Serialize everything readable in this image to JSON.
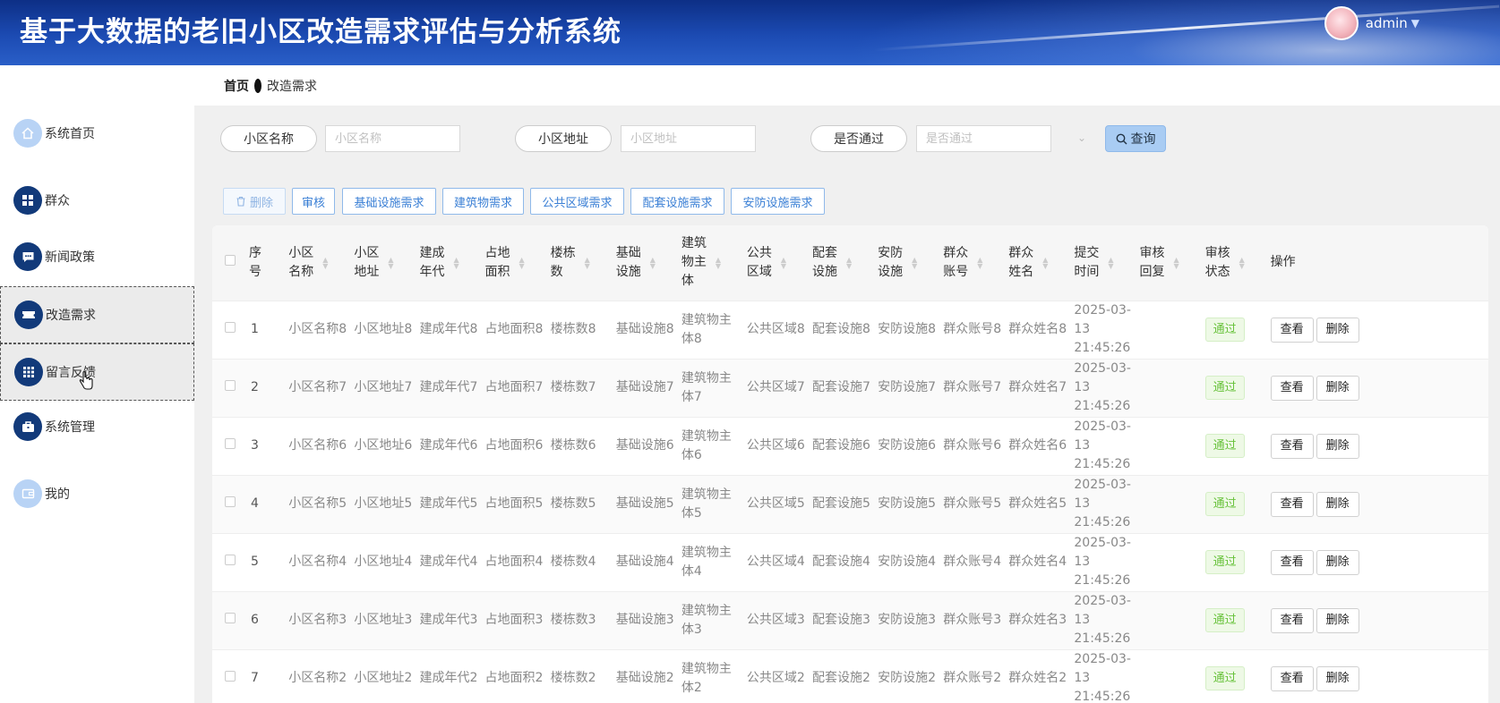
{
  "header": {
    "title": "基于大数据的老旧小区改造需求评估与分析系统",
    "user": "admin"
  },
  "sidebar": {
    "items": [
      {
        "label": "系统首页",
        "icon": "home-icon"
      },
      {
        "label": "群众",
        "icon": "grid-icon"
      },
      {
        "label": "新闻政策",
        "icon": "message-icon"
      },
      {
        "label": "改造需求",
        "icon": "ticket-icon"
      },
      {
        "label": "留言反馈",
        "icon": "apps-icon"
      },
      {
        "label": "系统管理",
        "icon": "briefcase-icon"
      },
      {
        "label": "我的",
        "icon": "wallet-icon"
      }
    ]
  },
  "breadcrumb": {
    "home": "首页",
    "current": "改造需求"
  },
  "search": {
    "name_label": "小区名称",
    "name_placeholder": "小区名称",
    "address_label": "小区地址",
    "address_placeholder": "小区地址",
    "passed_label": "是否通过",
    "passed_placeholder": "是否通过",
    "query_label": "查询"
  },
  "toolbar": {
    "delete": "删除",
    "audit": "审核",
    "infra": "基础设施需求",
    "building": "建筑物需求",
    "public": "公共区域需求",
    "supporting": "配套设施需求",
    "security": "安防设施需求"
  },
  "table": {
    "headers": [
      "序号",
      "小区名称",
      "小区地址",
      "建成年代",
      "占地面积",
      "楼栋数",
      "基础设施",
      "建筑物主体",
      "公共区域",
      "配套设施",
      "安防设施",
      "群众账号",
      "群众姓名",
      "提交时间",
      "审核回复",
      "审核状态",
      "操作"
    ],
    "view_label": "查看",
    "delete_label": "删除",
    "rows": [
      {
        "idx": "1",
        "name": "小区名称8",
        "addr": "小区地址8",
        "year": "建成年代8",
        "area": "占地面积8",
        "bldg": "楼栋数8",
        "infra": "基础设施8",
        "main": "建筑物主体8",
        "pub": "公共区域8",
        "supp": "配套设施8",
        "sec": "安防设施8",
        "acct": "群众账号8",
        "uname": "群众姓名8",
        "time": "2025-03-13 21:45:26",
        "reply": "",
        "status": "通过"
      },
      {
        "idx": "2",
        "name": "小区名称7",
        "addr": "小区地址7",
        "year": "建成年代7",
        "area": "占地面积7",
        "bldg": "楼栋数7",
        "infra": "基础设施7",
        "main": "建筑物主体7",
        "pub": "公共区域7",
        "supp": "配套设施7",
        "sec": "安防设施7",
        "acct": "群众账号7",
        "uname": "群众姓名7",
        "time": "2025-03-13 21:45:26",
        "reply": "",
        "status": "通过"
      },
      {
        "idx": "3",
        "name": "小区名称6",
        "addr": "小区地址6",
        "year": "建成年代6",
        "area": "占地面积6",
        "bldg": "楼栋数6",
        "infra": "基础设施6",
        "main": "建筑物主体6",
        "pub": "公共区域6",
        "supp": "配套设施6",
        "sec": "安防设施6",
        "acct": "群众账号6",
        "uname": "群众姓名6",
        "time": "2025-03-13 21:45:26",
        "reply": "",
        "status": "通过"
      },
      {
        "idx": "4",
        "name": "小区名称5",
        "addr": "小区地址5",
        "year": "建成年代5",
        "area": "占地面积5",
        "bldg": "楼栋数5",
        "infra": "基础设施5",
        "main": "建筑物主体5",
        "pub": "公共区域5",
        "supp": "配套设施5",
        "sec": "安防设施5",
        "acct": "群众账号5",
        "uname": "群众姓名5",
        "time": "2025-03-13 21:45:26",
        "reply": "",
        "status": "通过"
      },
      {
        "idx": "5",
        "name": "小区名称4",
        "addr": "小区地址4",
        "year": "建成年代4",
        "area": "占地面积4",
        "bldg": "楼栋数4",
        "infra": "基础设施4",
        "main": "建筑物主体4",
        "pub": "公共区域4",
        "supp": "配套设施4",
        "sec": "安防设施4",
        "acct": "群众账号4",
        "uname": "群众姓名4",
        "time": "2025-03-13 21:45:26",
        "reply": "",
        "status": "通过"
      },
      {
        "idx": "6",
        "name": "小区名称3",
        "addr": "小区地址3",
        "year": "建成年代3",
        "area": "占地面积3",
        "bldg": "楼栋数3",
        "infra": "基础设施3",
        "main": "建筑物主体3",
        "pub": "公共区域3",
        "supp": "配套设施3",
        "sec": "安防设施3",
        "acct": "群众账号3",
        "uname": "群众姓名3",
        "time": "2025-03-13 21:45:26",
        "reply": "",
        "status": "通过"
      },
      {
        "idx": "7",
        "name": "小区名称2",
        "addr": "小区地址2",
        "year": "建成年代2",
        "area": "占地面积2",
        "bldg": "楼栋数2",
        "infra": "基础设施2",
        "main": "建筑物主体2",
        "pub": "公共区域2",
        "supp": "配套设施2",
        "sec": "安防设施2",
        "acct": "群众账号2",
        "uname": "群众姓名2",
        "time": "2025-03-13 21:45:26",
        "reply": "",
        "status": "通过"
      }
    ]
  },
  "colors": {
    "header_blue": "#1c4bb3",
    "accent_blue": "#3a7fd5",
    "pass_green": "#67c23a",
    "icon_dark": "#123a7a",
    "icon_light": "#b8d3f5"
  }
}
